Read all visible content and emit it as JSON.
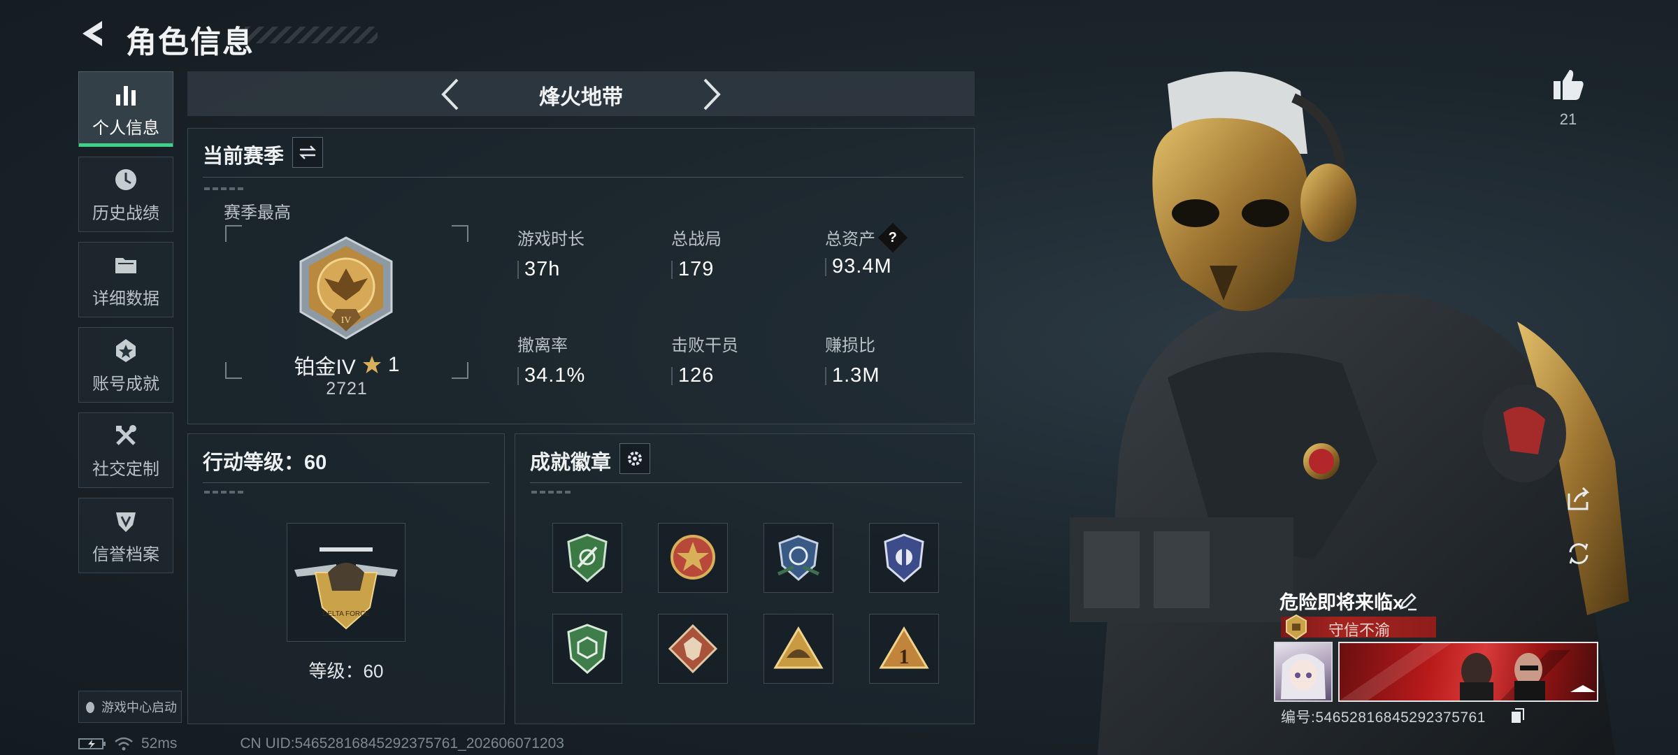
{
  "header": {
    "title": "角色信息"
  },
  "nav": {
    "items": [
      {
        "label": "个人信息",
        "icon": "bar-chart-icon",
        "active": true
      },
      {
        "label": "历史战绩",
        "icon": "clock-icon"
      },
      {
        "label": "详细数据",
        "icon": "folder-icon"
      },
      {
        "label": "账号成就",
        "icon": "achievement-icon"
      },
      {
        "label": "社交定制",
        "icon": "tools-icon"
      },
      {
        "label": "信誉档案",
        "icon": "shield-emblem-icon"
      }
    ],
    "game_center_label": "游戏中心启动"
  },
  "mode": {
    "title": "烽火地带"
  },
  "season": {
    "title": "当前赛季",
    "best_label": "赛季最高",
    "rank_name": "铂金IV",
    "rank_stars": "1",
    "rank_points": "2721",
    "stats": [
      {
        "label": "游戏时长",
        "value": "37h"
      },
      {
        "label": "总战局",
        "value": "179"
      },
      {
        "label": "总资产",
        "value": "93.4M",
        "help": "?"
      },
      {
        "label": "撤离率",
        "value": "34.1%"
      },
      {
        "label": "击败干员",
        "value": "126"
      },
      {
        "label": "赚损比",
        "value": "1.3M"
      }
    ]
  },
  "action_level": {
    "title": "行动等级：60",
    "level_label": "等级：60"
  },
  "badges": {
    "title": "成就徽章",
    "items": [
      {
        "icon": "green-shield-badge-icon",
        "color": "#3c7a45"
      },
      {
        "icon": "star-emblem-badge-icon",
        "color": "#b8483a"
      },
      {
        "icon": "blue-wings-badge-icon",
        "color": "#3a5a86"
      },
      {
        "icon": "navy-shield-badge-icon",
        "color": "#3c4b8a"
      },
      {
        "icon": "green-hex-badge-icon",
        "color": "#3f7d4a"
      },
      {
        "icon": "wolf-diamond-badge-icon",
        "color": "#a9533c"
      },
      {
        "icon": "gold-triangle-badge-icon",
        "color": "#c89a42"
      },
      {
        "icon": "number-one-badge-icon",
        "color": "#c0843a"
      }
    ]
  },
  "status": {
    "ping": "52ms",
    "uid": "CN UID:54652816845292375761_202606071203"
  },
  "profile": {
    "likes": "21",
    "card_name": "危险即将来临x",
    "honor_title": "守信不渝",
    "card_id": "编号:54652816845292375761"
  },
  "colors": {
    "accent_green": "#3fd38a",
    "honor_red": "#a5231f",
    "gold": "#c9a24a"
  }
}
